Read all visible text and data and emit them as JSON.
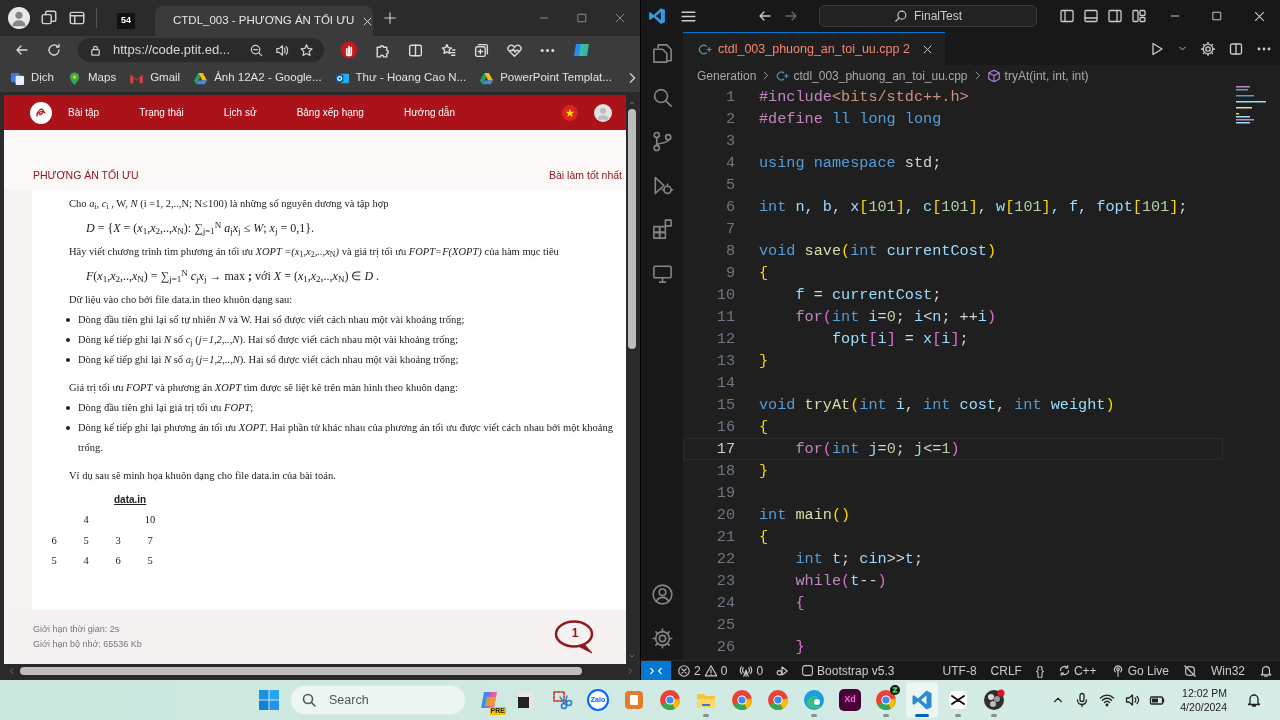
{
  "browser": {
    "tabs": [
      {
        "kind": "pinned",
        "label": "54",
        "selected": false
      },
      {
        "kind": "page",
        "label": "CTDL_003 - PHƯƠNG ÁN TỐI ƯU",
        "selected": true
      }
    ],
    "address": "https://code.ptit.ed...",
    "bookmarks": [
      {
        "kind": "translate",
        "label": "Dịch"
      },
      {
        "kind": "maps",
        "label": "Maps"
      },
      {
        "kind": "gmail",
        "label": "Gmail"
      },
      {
        "kind": "drive",
        "label": "Ảnh 12A2 - Google..."
      },
      {
        "kind": "outlook",
        "label": "Thư - Hoang Cao N..."
      },
      {
        "kind": "drive",
        "label": "PowerPoint Templat..."
      }
    ],
    "site": {
      "nav": [
        {
          "label": "Bài tập"
        },
        {
          "label": "Trạng thái"
        },
        {
          "label": "Lịch sử"
        },
        {
          "label": "Bảng xếp hạng"
        },
        {
          "label": "Hướng dẫn"
        }
      ],
      "title": "PHƯƠNG ÁN TỐI ƯU",
      "best_link": "Bài làm tốt nhất",
      "statement": [
        {
          "kind": "para",
          "text": "Cho *a*$_{i}$, *c*$_{i}$ , W, *N* (i =1, 2,..,N; N≤100) là những số nguyên dương  và tập hợp"
        },
        {
          "kind": "formula",
          "text": "*D* = {*X* = (*x*$_{1}$,*x*$_{2}$,..,*x*$_{N}$): ∑$_{j=1}$$^{N}$ *a*$_{j}$*x*$_{j}$ ≤ *W*; *x*$_{j}$ = 0,1}."
        },
        {
          "kind": "para",
          "text": "Hãy viết chương trình tìm phương án tối ưu *XOPT =(x*$_{1}$*,x*$_{2}$*,..,x*$_{N}$*)* và giá trị tối ưu *FOPT=F(XOPT)* của hàm mục tiêu"
        },
        {
          "kind": "formula",
          "text": "*F*(*x*$_{1}$,*x*$_{2}$,..,*x*$_{N}$) = ∑$_{j=1}$$^{N}$ *c*$_{j}$*x*$_{j}$ → max **;** với  *X* = (*x*$_{1}$,*x*$_{2}$,..,*x*$_{N}$) ∈ *D* ."
        },
        {
          "kind": "para",
          "text": "Dữ liệu vào cho bởi file data.in theo khuôn dạng sau:"
        },
        {
          "kind": "bullet",
          "text": "Dòng đầu tiên ghi lại số tự nhiên *N* và W. Hai số được viết cách nhau một vài khoảng trống;"
        },
        {
          "kind": "bullet",
          "text": "Dòng kế tiếp ghi lại *N* số *c*$_{j}$ (*j=1,2,..,N*). Hai số được viết cách nhau một vài khoảng trống;"
        },
        {
          "kind": "bullet",
          "text": "Dòng kế tiếp ghi lại *N* số *a*$_{j}$ (*j=1,2,..,N*). Hai số được viết cách nhau một vài khoảng trống;"
        },
        {
          "kind": "para",
          "text": "Giá trị tối ưu *FOPT* và phương án *XOPT* tìm được sẽ liệt kê trên màn hình theo khuôn dạng:"
        },
        {
          "kind": "bullet",
          "text": "Dòng đầu tiên ghi lại giá trị tối ưu *FOPT*;"
        },
        {
          "kind": "bullet",
          "text": "Dòng kế tiếp ghi lại phương án tối ưu *XOPT*. Hai phần tử khác nhau của phương án tối ưu được viết cách nhau bởi một khoảng trống."
        },
        {
          "kind": "para",
          "text": "Ví dụ sau sẽ minh họa khuôn dạng cho file data.in  của bài toán."
        }
      ],
      "sample": {
        "title": "data.in",
        "rows": [
          [
            null,
            "4",
            null,
            "10"
          ],
          [
            "6",
            "5",
            "3",
            "7"
          ],
          [
            "5",
            "4",
            "6",
            "5"
          ]
        ]
      },
      "limits": [
        "Giới hạn thời gian: 2s",
        "Giới hạn bộ nhớ: 65536 Kb"
      ],
      "chat_count": "1"
    }
  },
  "editor": {
    "search": "FinalTest",
    "tab": {
      "label": "ctdl_003_phuong_an_toi_uu.cpp",
      "problems": "2",
      "has_errors": true,
      "selected": true
    },
    "breadcrumb": [
      {
        "kind": "folder",
        "label": "Generation"
      },
      {
        "kind": "file",
        "label": "ctdl_003_phuong_an_toi_uu.cpp"
      },
      {
        "kind": "symbol",
        "label": "tryAt(int, int, int)"
      }
    ],
    "lines": [
      {
        "number": "1",
        "tokens": [
          {
            "kind": "pre",
            "text": "#include"
          },
          {
            "kind": "str",
            "text": "<bits/stdc++.h>"
          }
        ]
      },
      {
        "number": "2",
        "tokens": [
          {
            "kind": "pre",
            "text": "#define"
          },
          {
            "kind": "kw",
            "text": " ll long long"
          }
        ]
      },
      {
        "number": "3"
      },
      {
        "number": "4",
        "tokens": [
          {
            "kind": "kw",
            "text": "using namespace"
          },
          {
            "kind": "plain",
            "text": " std;"
          }
        ]
      },
      {
        "number": "5"
      },
      {
        "number": "6",
        "tokens": [
          {
            "kind": "kw",
            "text": "int"
          },
          {
            "kind": "var",
            "text": " n, b, x"
          },
          {
            "kind": "br1",
            "text": "["
          },
          {
            "kind": "num",
            "text": "101"
          },
          {
            "kind": "br1",
            "text": "]"
          },
          {
            "kind": "var",
            "text": ", c"
          },
          {
            "kind": "br1",
            "text": "["
          },
          {
            "kind": "num",
            "text": "101"
          },
          {
            "kind": "br1",
            "text": "]"
          },
          {
            "kind": "var",
            "text": ", w"
          },
          {
            "kind": "br1",
            "text": "["
          },
          {
            "kind": "num",
            "text": "101"
          },
          {
            "kind": "br1",
            "text": "]"
          },
          {
            "kind": "var",
            "text": ", f, fopt"
          },
          {
            "kind": "br1",
            "text": "["
          },
          {
            "kind": "num",
            "text": "101"
          },
          {
            "kind": "br1",
            "text": "]"
          },
          {
            "kind": "plain",
            "text": ";"
          }
        ]
      },
      {
        "number": "7"
      },
      {
        "number": "8",
        "tokens": [
          {
            "kind": "kw",
            "text": "void"
          },
          {
            "kind": "fn",
            "text": " save"
          },
          {
            "kind": "br1",
            "text": "("
          },
          {
            "kind": "kw",
            "text": "int"
          },
          {
            "kind": "var",
            "text": " currentCost"
          },
          {
            "kind": "br1",
            "text": ")"
          }
        ]
      },
      {
        "number": "9",
        "tokens": [
          {
            "kind": "br1",
            "text": "{"
          }
        ]
      },
      {
        "number": "10",
        "tokens": [
          {
            "kind": "var",
            "text": "    f"
          },
          {
            "kind": "plain",
            "text": " = "
          },
          {
            "kind": "var",
            "text": "currentCost"
          },
          {
            "kind": "plain",
            "text": ";"
          }
        ]
      },
      {
        "number": "11",
        "tokens": [
          {
            "kind": "ctl",
            "text": "    for"
          },
          {
            "kind": "br2",
            "text": "("
          },
          {
            "kind": "kw",
            "text": "int"
          },
          {
            "kind": "var",
            "text": " i"
          },
          {
            "kind": "plain",
            "text": "="
          },
          {
            "kind": "num",
            "text": "0"
          },
          {
            "kind": "plain",
            "text": "; "
          },
          {
            "kind": "var",
            "text": "i"
          },
          {
            "kind": "plain",
            "text": "<"
          },
          {
            "kind": "var",
            "text": "n"
          },
          {
            "kind": "plain",
            "text": "; ++"
          },
          {
            "kind": "var",
            "text": "i"
          },
          {
            "kind": "br2",
            "text": ")"
          }
        ]
      },
      {
        "number": "12",
        "tokens": [
          {
            "kind": "var",
            "text": "        fopt"
          },
          {
            "kind": "br2",
            "text": "["
          },
          {
            "kind": "var",
            "text": "i"
          },
          {
            "kind": "br2",
            "text": "]"
          },
          {
            "kind": "plain",
            "text": " = "
          },
          {
            "kind": "var",
            "text": "x"
          },
          {
            "kind": "br2",
            "text": "["
          },
          {
            "kind": "var",
            "text": "i"
          },
          {
            "kind": "br2",
            "text": "]"
          },
          {
            "kind": "plain",
            "text": ";"
          }
        ]
      },
      {
        "number": "13",
        "tokens": [
          {
            "kind": "br1",
            "text": "}"
          }
        ]
      },
      {
        "number": "14"
      },
      {
        "number": "15",
        "tokens": [
          {
            "kind": "kw",
            "text": "void"
          },
          {
            "kind": "fn",
            "text": " tryAt"
          },
          {
            "kind": "br1",
            "text": "("
          },
          {
            "kind": "kw",
            "text": "int"
          },
          {
            "kind": "var",
            "text": " i"
          },
          {
            "kind": "plain",
            "text": ", "
          },
          {
            "kind": "kw",
            "text": "int"
          },
          {
            "kind": "var",
            "text": " cost"
          },
          {
            "kind": "plain",
            "text": ", "
          },
          {
            "kind": "kw",
            "text": "int"
          },
          {
            "kind": "var",
            "text": " weight"
          },
          {
            "kind": "br1",
            "text": ")"
          }
        ]
      },
      {
        "number": "16",
        "tokens": [
          {
            "kind": "br1",
            "text": "{"
          }
        ]
      },
      {
        "number": "17",
        "current": true,
        "tokens": [
          {
            "kind": "ctl",
            "text": "    for"
          },
          {
            "kind": "br2",
            "text": "("
          },
          {
            "kind": "kw",
            "text": "int"
          },
          {
            "kind": "var",
            "text": " j"
          },
          {
            "kind": "plain",
            "text": "="
          },
          {
            "kind": "num",
            "text": "0"
          },
          {
            "kind": "plain",
            "text": "; "
          },
          {
            "kind": "var",
            "text": "j"
          },
          {
            "kind": "plain",
            "text": "<="
          },
          {
            "kind": "num",
            "text": "1"
          },
          {
            "kind": "br2",
            "text": ")"
          }
        ]
      },
      {
        "number": "18",
        "tokens": [
          {
            "kind": "br1",
            "text": "}"
          }
        ]
      },
      {
        "number": "19"
      },
      {
        "number": "20",
        "tokens": [
          {
            "kind": "kw",
            "text": "int"
          },
          {
            "kind": "fn",
            "text": " main"
          },
          {
            "kind": "br1",
            "text": "()"
          }
        ]
      },
      {
        "number": "21",
        "tokens": [
          {
            "kind": "br1",
            "text": "{"
          }
        ]
      },
      {
        "number": "22",
        "tokens": [
          {
            "kind": "kw",
            "text": "    int"
          },
          {
            "kind": "var",
            "text": " t"
          },
          {
            "kind": "plain",
            "text": "; "
          },
          {
            "kind": "var",
            "text": "cin"
          },
          {
            "kind": "plain",
            "text": ">>"
          },
          {
            "kind": "var",
            "text": "t"
          },
          {
            "kind": "plain",
            "text": ";"
          }
        ]
      },
      {
        "number": "23",
        "tokens": [
          {
            "kind": "ctl",
            "text": "    while"
          },
          {
            "kind": "br2",
            "text": "("
          },
          {
            "kind": "var",
            "text": "t"
          },
          {
            "kind": "plain",
            "text": "--"
          },
          {
            "kind": "br2",
            "text": ")"
          }
        ]
      },
      {
        "number": "24",
        "tokens": [
          {
            "kind": "br2",
            "text": "    {"
          }
        ]
      },
      {
        "number": "25"
      },
      {
        "number": "26",
        "tokens": [
          {
            "kind": "br2",
            "text": "    }"
          }
        ]
      }
    ]
  },
  "status_bar": {
    "left": [
      {
        "kind": "remote"
      },
      {
        "kind": "problems",
        "errors": "2",
        "warnings": "0"
      },
      {
        "kind": "ports",
        "text": "0"
      },
      {
        "kind": "run"
      },
      {
        "kind": "bootstrap",
        "text": "Bootstrap v5.3"
      }
    ],
    "right": [
      {
        "kind": "text",
        "text": "UTF-8"
      },
      {
        "kind": "text",
        "text": "CRLF"
      },
      {
        "kind": "text",
        "text": "{}"
      },
      {
        "kind": "language",
        "text": "C++"
      },
      {
        "kind": "golive",
        "text": "Go Live"
      },
      {
        "kind": "copilot"
      },
      {
        "kind": "text",
        "text": "Win32"
      },
      {
        "kind": "bell"
      }
    ]
  },
  "taskbar": {
    "search_placeholder": "Search",
    "apps": [
      {
        "kind": "copilot",
        "label": "PRE",
        "running": false,
        "selected": false
      },
      {
        "kind": "taskview",
        "running": false,
        "selected": false
      },
      {
        "kind": "snip",
        "running": false,
        "selected": false
      },
      {
        "kind": "zalo",
        "label": "Zalo",
        "running": false,
        "selected": false
      },
      {
        "kind": "office",
        "running": false,
        "selected": false
      },
      {
        "kind": "chrome",
        "running": false,
        "selected": false
      },
      {
        "kind": "explorer",
        "running": true,
        "selected": false
      },
      {
        "kind": "chrome",
        "running": false,
        "selected": false
      },
      {
        "kind": "chrome",
        "running": false,
        "selected": false
      },
      {
        "kind": "edge",
        "running": true,
        "selected": false
      },
      {
        "kind": "xd",
        "label": "Xd",
        "running": false,
        "selected": false
      },
      {
        "kind": "chrome",
        "running": true,
        "selected": false
      },
      {
        "kind": "vscode",
        "running": true,
        "selected": true
      },
      {
        "kind": "capcut",
        "running": true,
        "selected": false
      },
      {
        "kind": "obs",
        "running": true,
        "selected": false
      }
    ],
    "time": "12:02 PM",
    "date": "4/20/2024"
  }
}
